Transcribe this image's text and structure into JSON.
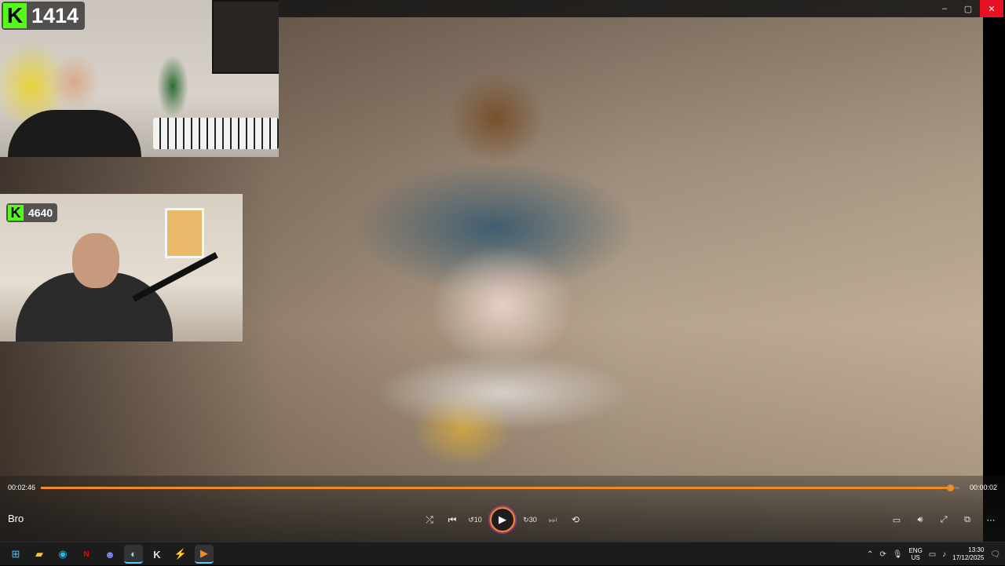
{
  "player": {
    "title": "Bro",
    "time_elapsed": "00:02:46",
    "time_remaining": "00:00:02",
    "progress": 0.9895,
    "accent_color": "#f08a24"
  },
  "overlays": {
    "streamer1_count": "1414",
    "streamer2_count": "4640",
    "kick_letter": "K",
    "kick_color": "#53fc18"
  },
  "controls": {
    "shuffle": "shuffle-icon",
    "previous": "previous-icon",
    "rewind": "rewind-10-icon",
    "rewind_label": "10",
    "play": "play-icon",
    "forward": "forward-30-icon",
    "forward_label": "30",
    "next": "next-icon",
    "repeat": "repeat-off-icon"
  },
  "window": {
    "minimize": "–",
    "maximize": "▢",
    "close": "✕"
  },
  "taskbar": {
    "apps": [
      "windows-start-icon",
      "file-explorer-icon",
      "edge-icon",
      "netflix-icon",
      "discord-icon",
      "steam-icon",
      "kick-icon",
      "winamp-icon",
      "media-player-icon"
    ],
    "language_top": "ENG",
    "language_bottom": "US",
    "time": "13:30",
    "date": "17/12/2025"
  }
}
